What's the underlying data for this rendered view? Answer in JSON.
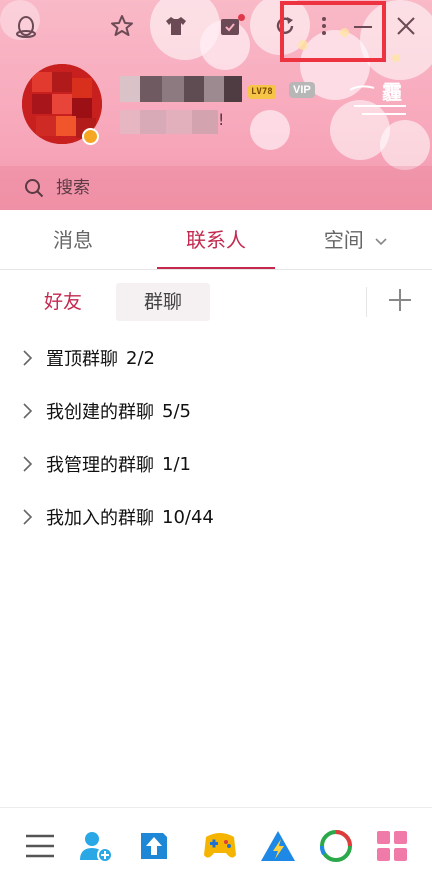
{
  "header": {
    "level_badge": "LV78",
    "vip_badge": "VIP",
    "signature_suffix": "!",
    "weather_glyph": "霾"
  },
  "titlebar": {
    "icons": [
      "favorites-star-icon",
      "shirt-icon",
      "calendar-icon",
      "refresh-icon",
      "more-menu-icon",
      "minimize-icon",
      "close-icon"
    ]
  },
  "search": {
    "placeholder": "搜索"
  },
  "main_tabs": [
    {
      "label": "消息"
    },
    {
      "label": "联系人"
    },
    {
      "label": "空间"
    }
  ],
  "active_main_tab": "联系人",
  "sub_tabs": [
    {
      "label": "好友"
    },
    {
      "label": "群聊"
    }
  ],
  "active_sub_tab": "好友",
  "groups": [
    {
      "label": "置顶群聊",
      "count": "2/2"
    },
    {
      "label": "我创建的群聊",
      "count": "5/5"
    },
    {
      "label": "我管理的群聊",
      "count": "1/1"
    },
    {
      "label": "我加入的群聊",
      "count": "10/44"
    }
  ],
  "toolbar": {
    "icons": [
      "main-menu-icon",
      "add-friend-icon",
      "file-transfer-icon",
      "game-center-icon",
      "tencent-tools-icon",
      "tencent-video-icon",
      "app-manager-icon"
    ]
  },
  "colors": {
    "accent": "#c4294f",
    "header_pink": "#f8aabd",
    "highlight_red": "#ee3340"
  }
}
